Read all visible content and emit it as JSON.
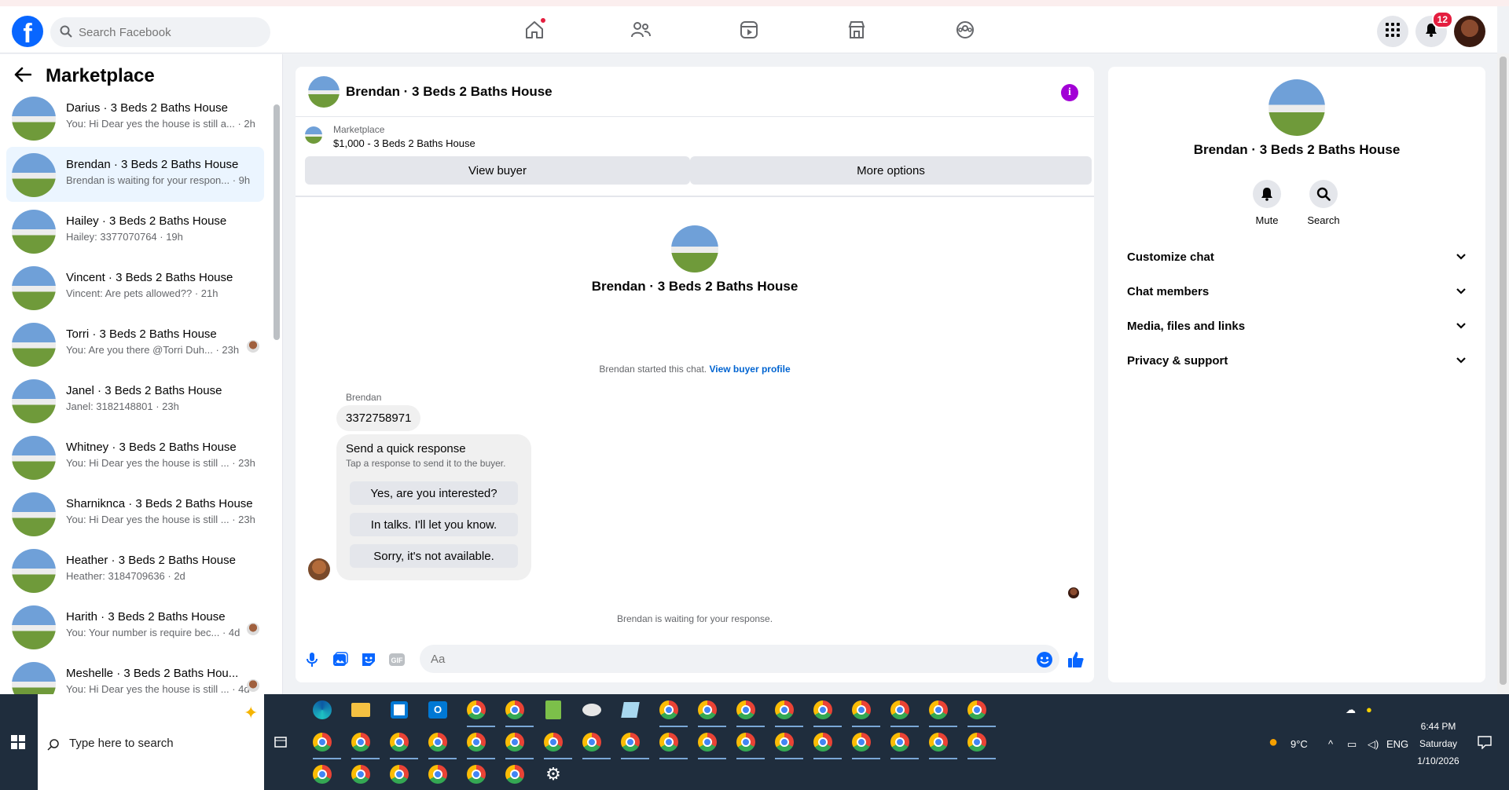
{
  "header": {
    "logo": "f",
    "search_placeholder": "Search Facebook",
    "notification_count": "12",
    "nav_icons": [
      "home-icon",
      "friends-icon",
      "video-icon",
      "marketplace-icon",
      "groups-icon"
    ]
  },
  "sidebar": {
    "title": "Marketplace",
    "conversations": [
      {
        "name": "Darius · 3 Beds 2 Baths House",
        "snippet": "You: Hi Dear yes the house is still a... · 2h"
      },
      {
        "name": "Brendan · 3 Beds 2 Baths House",
        "snippet": "Brendan is waiting for your respon... · 9h"
      },
      {
        "name": "Hailey · 3 Beds 2 Baths House",
        "snippet": "Hailey: 3377070764 · 19h"
      },
      {
        "name": "Vincent · 3 Beds 2 Baths House",
        "snippet": "Vincent: Are pets allowed?? · 21h"
      },
      {
        "name": "Torri · 3 Beds 2 Baths House",
        "snippet": "You: Are you there @Torri Duh... · 23h"
      },
      {
        "name": "Janel · 3 Beds 2 Baths House",
        "snippet": "Janel: 3182148801 · 23h"
      },
      {
        "name": "Whitney · 3 Beds 2 Baths House",
        "snippet": "You: Hi Dear yes the house is still ... · 23h"
      },
      {
        "name": "Sharniknca · 3 Beds 2 Baths House",
        "snippet": "You: Hi Dear yes the house is still ... · 23h"
      },
      {
        "name": "Heather · 3 Beds 2 Baths House",
        "snippet": "Heather: 3184709636 · 2d"
      },
      {
        "name": "Harith · 3 Beds 2 Baths House",
        "snippet": "You: Your number is require bec... · 4d"
      },
      {
        "name": "Meshelle · 3 Beds 2 Baths Hou...",
        "snippet": "You: Hi Dear yes the house is still ... · 4d"
      }
    ]
  },
  "chat": {
    "title": "Brendan · 3 Beds 2 Baths House",
    "listing_source": "Marketplace",
    "listing": "$1,000 - 3 Beds 2 Baths House",
    "view_buyer": "View buyer",
    "more_options": "More options",
    "started_text": "Brendan started this chat.",
    "view_buyer_profile": "View buyer profile",
    "sender": "Brendan",
    "message": "3372758971",
    "quick_title": "Send a quick response",
    "quick_sub": "Tap a response to send it to the buyer.",
    "quick_replies": [
      "Yes, are you interested?",
      "In talks. I'll let you know.",
      "Sorry, it's not available."
    ],
    "waiting": "Brendan is waiting for your response.",
    "composer_placeholder": "Aa"
  },
  "right_panel": {
    "name": "Brendan · 3 Beds 2 Baths House",
    "mute": "Mute",
    "search": "Search",
    "sections": [
      "Customize chat",
      "Chat members",
      "Media, files and links",
      "Privacy & support"
    ]
  },
  "taskbar": {
    "search_placeholder": "Type here to search",
    "weather": "9°C",
    "language": "ENG",
    "time": "6:44 PM",
    "day": "Saturday",
    "date": "1/10/2026"
  }
}
